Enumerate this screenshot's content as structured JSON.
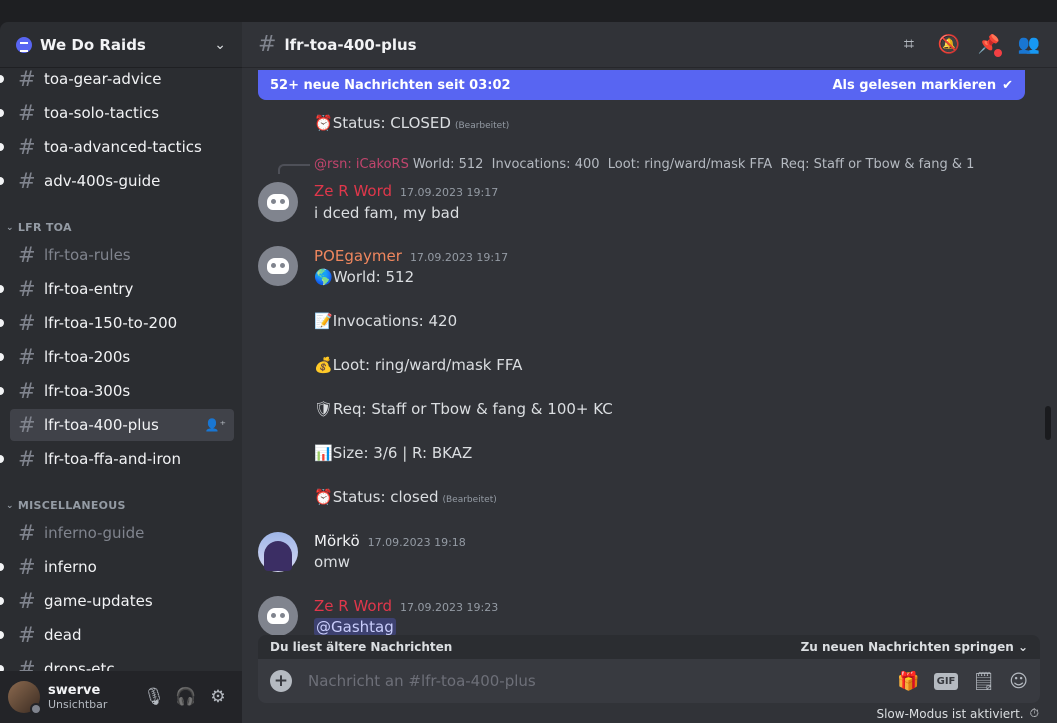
{
  "server": {
    "name": "We Do Raids"
  },
  "channels_top": [
    {
      "name": "toa-gear-advice"
    },
    {
      "name": "toa-solo-tactics"
    },
    {
      "name": "toa-advanced-tactics"
    },
    {
      "name": "adv-400s-guide"
    }
  ],
  "category_lfr": "LFR TOA",
  "channels_lfr": [
    {
      "name": "lfr-toa-rules"
    },
    {
      "name": "lfr-toa-entry"
    },
    {
      "name": "lfr-toa-150-to-200"
    },
    {
      "name": "lfr-toa-200s"
    },
    {
      "name": "lfr-toa-300s"
    },
    {
      "name": "lfr-toa-400-plus"
    },
    {
      "name": "lfr-toa-ffa-and-iron"
    }
  ],
  "category_misc": "MISCELLANEOUS",
  "channels_misc": [
    {
      "name": "inferno-guide"
    },
    {
      "name": "inferno"
    },
    {
      "name": "game-updates"
    },
    {
      "name": "dead"
    },
    {
      "name": "drops-etc"
    }
  ],
  "user": {
    "name": "swerve",
    "status": "Unsichtbar"
  },
  "channel_header": {
    "title": "lfr-toa-400-plus"
  },
  "banner": {
    "text": "52+ neue Nachrichten seit 03:02",
    "mark_read": "Als gelesen markieren"
  },
  "messages": {
    "prev_status": "Status: CLOSED",
    "edited_label": "(Bearbeitet)",
    "reply": {
      "name": "@rsn: iCakoRS",
      "text": "World: 512  Invocations: 400  Loot: ring/ward/mask FFA  Req: Staff or Tbow & fang & 1"
    },
    "m1": {
      "author": "Ze R Word",
      "time": "17.09.2023 19:17",
      "text": "i dced fam, my bad"
    },
    "m2": {
      "author": "POEgaymer",
      "time": "17.09.2023 19:17",
      "world": "World: 512",
      "invocations": "Invocations:  420",
      "loot": "Loot: ring/ward/mask FFA",
      "req": "Req: Staff or Tbow & fang & 100+ KC",
      "size": "Size: 3/6 |  R: BKAZ",
      "status": "Status: closed"
    },
    "m3": {
      "author": "Mörkö",
      "time": "17.09.2023 19:18",
      "text": "omw"
    },
    "m4": {
      "author": "Ze R Word",
      "time": "17.09.2023 19:23",
      "mention": "@Gashtag"
    }
  },
  "older_bar": {
    "text": "Du liest ältere Nachrichten",
    "jump": "Zu neuen Nachrichten springen"
  },
  "composer": {
    "placeholder": "Nachricht an #lfr-toa-400-plus",
    "gif": "GIF"
  },
  "slowmode": "Slow-Modus ist aktiviert.",
  "colors": {
    "accent": "#5865f2",
    "author_red": "#e0374b",
    "author_orange": "#f0875e",
    "author_white": "#f2f3f5"
  }
}
